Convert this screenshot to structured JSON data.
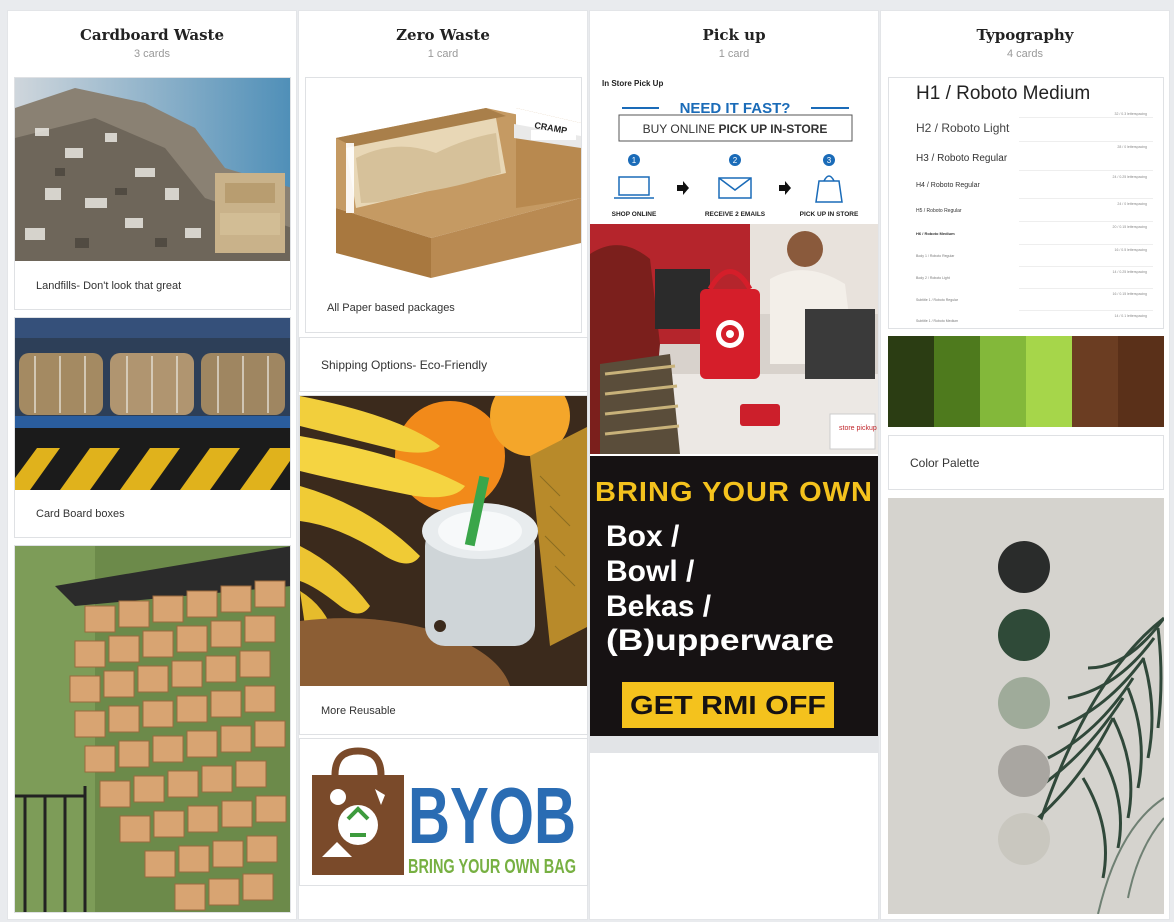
{
  "columns": [
    {
      "title": "Cardboard Waste",
      "count": "3 cards",
      "cards": [
        {
          "caption": "Landfills- Don't look that great"
        },
        {
          "caption": "Card Board boxes"
        },
        {
          "caption": ""
        }
      ]
    },
    {
      "title": "Zero Waste",
      "count": "1 card",
      "cards": [
        {
          "caption": "All Paper based packages"
        },
        {
          "caption": "Shipping Options- Eco-Friendly"
        },
        {
          "caption": "More Reusable"
        },
        {
          "caption": ""
        }
      ]
    },
    {
      "title": "Pick up",
      "count": "1 card",
      "cards": []
    },
    {
      "title": "Typography",
      "count": "4 cards",
      "cards": [
        {
          "caption": "Color Palette"
        }
      ]
    }
  ],
  "box_label": "CRAMP",
  "pickup_graphic": {
    "header": "In Store Pick Up",
    "headline": "NEED IT FAST?",
    "sub_a": "BUY ONLINE ",
    "sub_b": "PICK UP IN-STORE",
    "step_numbers": [
      "1",
      "2",
      "3"
    ],
    "steps": [
      "SHOP ONLINE",
      "RECEIVE 2 EMAILS",
      "PICK UP IN STORE"
    ]
  },
  "store_sign": "store pickup",
  "byo_poster": {
    "title": "BRING YOUR OWN",
    "lines": [
      "Box /",
      "Bowl /",
      "Bekas /",
      "(B)upperware"
    ],
    "cta": "GET RMI OFF"
  },
  "byob_logo": {
    "letters": "BYOB",
    "tagline": "BRING YOUR OWN BAG"
  },
  "typography": {
    "styles": [
      {
        "label": "H1 / Roboto Medium",
        "note": ""
      },
      {
        "label": "H2 / Roboto Light",
        "note": "32 / 0.3 letterspacing"
      },
      {
        "label": "H3 / Roboto Regular",
        "note": "28 / 0 letterspacing"
      },
      {
        "label": "H4 / Roboto Regular",
        "note": "24 / 0.25 letterspacing"
      },
      {
        "label": "H5 / Roboto Regular",
        "note": "24 / 0 letterspacing"
      },
      {
        "label": "H6 / Roboto Medium",
        "note": "20 / 0.15 letterspacing"
      },
      {
        "label": "Body 1 / Roboto Regular",
        "note": "16 / 0.5 letterspacing"
      },
      {
        "label": "Body 2 / Roboto Light",
        "note": "14 / 0.25 letterspacing"
      },
      {
        "label": "Subtitle 1 / Roboto Regular",
        "note": "16 / 0.15 letterspacing"
      },
      {
        "label": "Subtitle 1 / Roboto Medium",
        "note": "14 / 0.1 letterspacing"
      }
    ]
  },
  "palette_colors": [
    "#2b3d13",
    "#4e7a1d",
    "#83b83a",
    "#a6d64a",
    "#6b3d22",
    "#5a3019"
  ],
  "swatch_colors": [
    "#2a2c2b",
    "#2f4a38",
    "#9fab9a",
    "#a9a6a1",
    "#c9c7bf"
  ]
}
